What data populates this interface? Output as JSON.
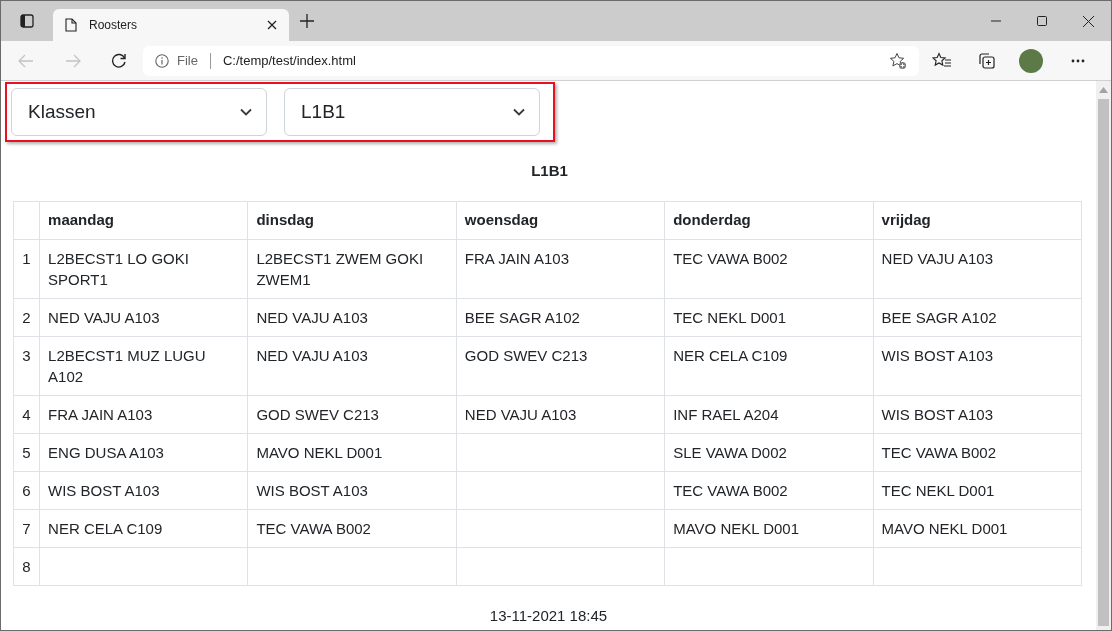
{
  "browser": {
    "tab_title": "Roosters",
    "address_prefix": "File",
    "url": "C:/temp/test/index.html"
  },
  "selects": [
    {
      "value": "Klassen"
    },
    {
      "value": "L1B1"
    }
  ],
  "title": "L1B1",
  "table": {
    "columns": [
      "maandag",
      "dinsdag",
      "woensdag",
      "donderdag",
      "vrijdag"
    ],
    "rows": [
      {
        "number": "1",
        "cells": [
          "L2BECST1 LO GOKI SPORT1",
          "L2BECST1 ZWEM GOKI ZWEM1",
          "FRA JAIN A103",
          "TEC VAWA B002",
          "NED VAJU A103"
        ]
      },
      {
        "number": "2",
        "cells": [
          "NED VAJU A103",
          "NED VAJU A103",
          "BEE SAGR A102",
          "TEC NEKL D001",
          "BEE SAGR A102"
        ]
      },
      {
        "number": "3",
        "cells": [
          "L2BECST1 MUZ LUGU A102",
          "NED VAJU A103",
          "GOD SWEV C213",
          "NER CELA C109",
          "WIS BOST A103"
        ]
      },
      {
        "number": "4",
        "cells": [
          "FRA JAIN A103",
          "GOD SWEV C213",
          "NED VAJU A103",
          "INF RAEL A204",
          "WIS BOST A103"
        ]
      },
      {
        "number": "5",
        "cells": [
          "ENG DUSA A103",
          "MAVO NEKL D001",
          null,
          "SLE VAWA D002",
          "TEC VAWA B002"
        ]
      },
      {
        "number": "6",
        "cells": [
          "WIS BOST A103",
          "WIS BOST A103",
          null,
          "TEC VAWA B002",
          "TEC NEKL D001"
        ]
      },
      {
        "number": "7",
        "cells": [
          "NER CELA C109",
          "TEC VAWA B002",
          null,
          "MAVO NEKL D001",
          "MAVO NEKL D001"
        ]
      },
      {
        "number": "8",
        "cells": [
          null,
          null,
          null,
          null,
          null
        ]
      }
    ]
  },
  "footer": "13-11-2021 18:45"
}
